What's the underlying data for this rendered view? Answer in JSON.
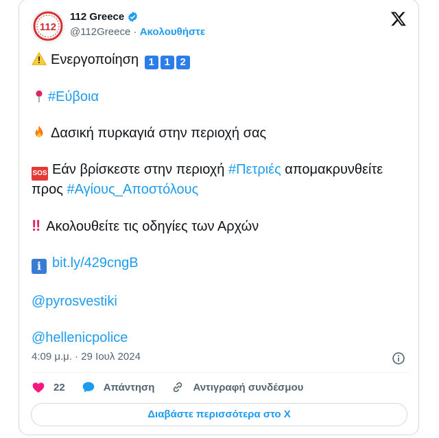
{
  "account": {
    "name": "112 Greece",
    "handle": "@112Greece",
    "separator": " · ",
    "follow_label": "Ακολουθήστε",
    "avatar_text": "112"
  },
  "tweet": {
    "line1_text": "Ενεργοποίηση",
    "line1_keys": [
      "1",
      "1",
      "2"
    ],
    "line2_tag": "#Εύβοια",
    "line3_text": "Δασική πυρκαγιά στην περιοχή σας",
    "line4_sos": "SOS",
    "line4_text_a": "Εάν βρίσκεστε στην περιοχή ",
    "line4_tag1": "#Πετριές",
    "line4_text_b": " απομακρυνθείτε προς ",
    "line4_tag2": "#Αγίους_Αποστόλους",
    "line5_bangs": "‼",
    "line5_text": "Ακολουθείτε τις οδηγίες των Αρχών",
    "line6_icon": "i",
    "line6_link": "bit.ly/429cngB",
    "mention1": "@pyrosvestiki",
    "mention2": "@hellenicpolice"
  },
  "timestamp": "4:09 μ.μ. · 29 Ιουλ 2024",
  "actions": {
    "like_count": "22",
    "reply_label": "Απάντηση",
    "copy_link_label": "Αντιγραφή συνδέσμου"
  },
  "read_more_label": "Διαβάστε περισσότερα στο X",
  "icons": {
    "warning": "warning-icon",
    "pin": "pushpin-icon",
    "fire": "fire-icon",
    "heart": "heart-icon",
    "reply": "reply-bubble-icon",
    "link": "link-icon",
    "info": "info-circle-icon",
    "x_logo": "x-logo-icon",
    "verified": "verified-badge-icon"
  },
  "colors": {
    "accent": "#1d9bf0",
    "heart": "#f91880",
    "text": "#0f1419",
    "muted": "#536471",
    "brand_red": "#d32f2f"
  }
}
